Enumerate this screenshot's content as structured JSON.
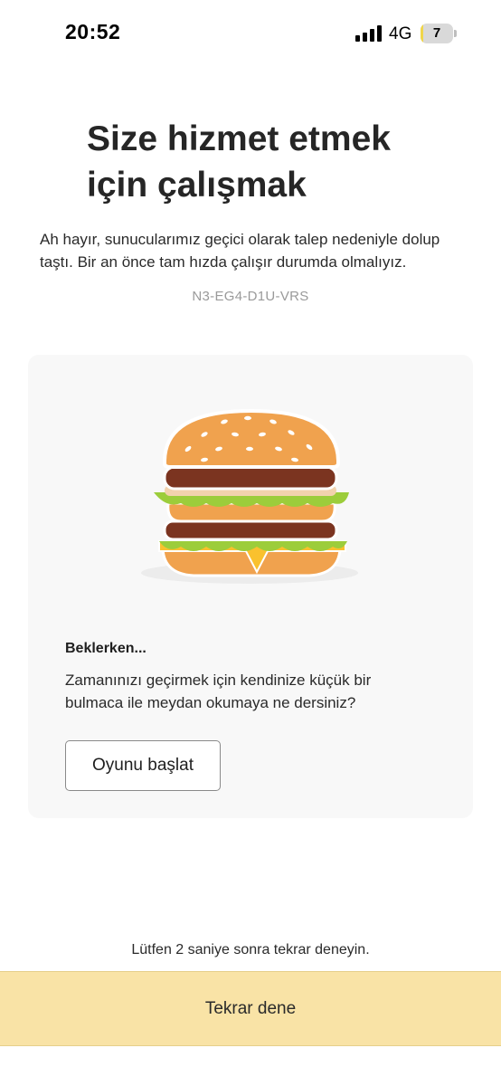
{
  "status_bar": {
    "time": "20:52",
    "network": "4G",
    "battery_level": "7",
    "battery_fraction": 0.07
  },
  "main": {
    "title_line1": "Size hizmet etmek",
    "title_line2": "için çalışmak",
    "description": "Ah hayır, sunucularımız geçici olarak talep nedeniyle dolup taştı. Bir an önce tam hızda çalışır durumda olmalıyız.",
    "error_code": "N3-EG4-D1U-VRS"
  },
  "card": {
    "illustration": "burger-illustration",
    "heading": "Beklerken...",
    "text": "Zamanınızı geçirmek için kendinize küçük bir bulmaca ile meydan okumaya ne dersiniz?",
    "button_label": "Oyunu başlat"
  },
  "footer": {
    "retry_message": "Lütfen 2 saniye sonra tekrar deneyin.",
    "retry_button_label": "Tekrar dene"
  },
  "colors": {
    "retry_button_bg": "#f9e3a6",
    "card_bg": "#f8f8f8",
    "bun": "#f0a24e",
    "patty": "#7b3420",
    "lettuce": "#9ccd3b",
    "cheese": "#f9c12e"
  }
}
